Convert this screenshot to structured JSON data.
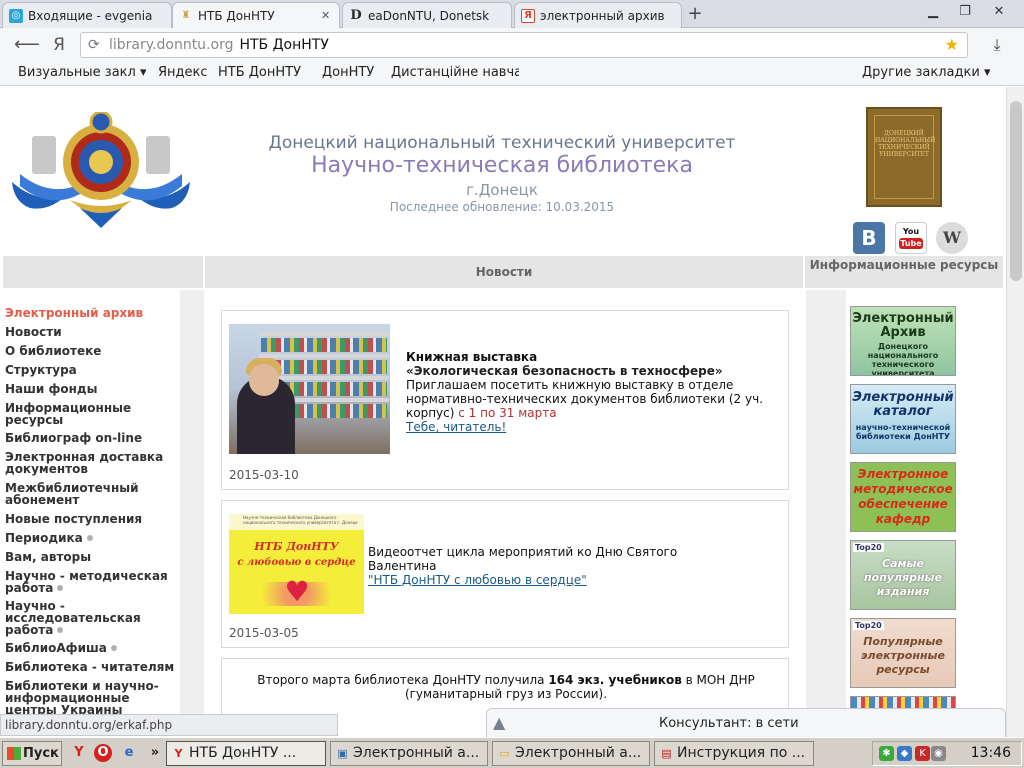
{
  "browser": {
    "tabs": [
      {
        "label": "Входящие - evgenia",
        "icon_color": "#2aa6d6"
      },
      {
        "label": "НТБ ДонНТУ",
        "icon_color": "#c8a040"
      },
      {
        "label": "eaDonNTU, Donetsk",
        "icon_color": "#2a2a2a"
      },
      {
        "label": "электронный архив",
        "icon_color": "#e04030"
      }
    ],
    "active_tab": 1,
    "window_controls": [
      "▁",
      "❐",
      "✕"
    ],
    "address": {
      "host": "library.donntu.org",
      "page": "НТБ ДонНТУ",
      "yandex_glyph": "Я"
    },
    "bookmarks": [
      "Визуальные закл ▾",
      "Яндекс",
      "НТБ ДонНТУ",
      "ДонНТУ",
      "Дистанційне навча",
      "Другие закладки ▾"
    ]
  },
  "header": {
    "university": "Донецкий национальный технический университет",
    "library": "Научно-техническая библиотека",
    "city": "г.Донецк",
    "updated": "Последнее обновление: 10.03.2015",
    "book_cover_text": "ДОНЕЦКИЙ НАЦИОНАЛЬНЫЙ ТЕХНИЧЕСКИЙ УНИВЕРСИТЕТ",
    "social": {
      "vk": "В",
      "youtube_top": "You",
      "youtube_bottom": "Tube",
      "wiki": "W"
    }
  },
  "section_bar": {
    "news": "Новости",
    "resources": "Информационные ресурсы"
  },
  "nav": [
    {
      "label": "Электронный архив",
      "active": true,
      "dot": false
    },
    {
      "label": "Новости",
      "active": false,
      "dot": false
    },
    {
      "label": "О библиотеке",
      "active": false,
      "dot": false
    },
    {
      "label": "Структура",
      "active": false,
      "dot": false
    },
    {
      "label": "Наши фонды",
      "active": false,
      "dot": false
    },
    {
      "label": "Информационные ресурсы",
      "active": false,
      "dot": false
    },
    {
      "label": "Библиограф on-line",
      "active": false,
      "dot": false
    },
    {
      "label": "Электронная доставка документов",
      "active": false,
      "dot": false
    },
    {
      "label": "Межбиблиотечный абонемент",
      "active": false,
      "dot": false
    },
    {
      "label": "Новые поступления",
      "active": false,
      "dot": false
    },
    {
      "label": "Периодика",
      "active": false,
      "dot": true
    },
    {
      "label": "Вам, авторы",
      "active": false,
      "dot": false
    },
    {
      "label": "Научно - методическая работа",
      "active": false,
      "dot": true
    },
    {
      "label": "Научно - исследовательская работа",
      "active": false,
      "dot": true
    },
    {
      "label": "БиблиоАфиша",
      "active": false,
      "dot": true
    },
    {
      "label": "Библиотека - читателям",
      "active": false,
      "dot": false
    },
    {
      "label": "Библиотеки и научно-информационные центры Украины",
      "active": false,
      "dot": false
    }
  ],
  "news": [
    {
      "title": "Книжная выставка",
      "subtitle": "«Экологическая безопасность в техносфере»",
      "text": "Приглашаем посетить книжную выставку в отделе нормативно-технических документов библиотеки (2 уч. корпус) ",
      "text_highlight": "с 1 по 31 марта",
      "link": "Тебе, читатель!",
      "date": "2015-03-10"
    },
    {
      "text": "Видеоотчет цикла мероприятий ко Дню Святого Валентина",
      "link": "\"НТБ ДонНТУ с любовью в сердце\"",
      "banner_line1": "НТБ ДонНТУ",
      "banner_line2": "с любовью в сердце",
      "banner_header": "Научно-техническая библиотека Донецкого национального технического университета г. Донецк",
      "date": "2015-03-05"
    },
    {
      "text_before": "Второго марта библиотека ДонНТУ получила ",
      "text_bold": "164 экз. учебников",
      "text_after": " в МОН ДНР (гуманитарный груз из России)."
    }
  ],
  "resources": [
    {
      "title": "Электронный Архив",
      "sub": "Донецкого национального технического университета"
    },
    {
      "title": "Электронный каталог",
      "sub": "научно-технической библиотеки ДонНТУ"
    },
    {
      "title": "Электронное методическое обеспечение кафедр"
    },
    {
      "badge": "Top20",
      "ghost": "Самые популярные издания"
    },
    {
      "badge": "Top20",
      "ghost": "Популярные электронные ресурсы"
    }
  ],
  "status_url": "library.donntu.org/erkaf.php",
  "consultant": "Консультант: в сети",
  "taskbar": {
    "start": "Пуск",
    "more": "»",
    "tasks": [
      {
        "label": "НТБ ДонНТУ ...",
        "icon": "Y",
        "icon_color": "#d42020"
      },
      {
        "label": "Электронный а...",
        "icon": "▣",
        "icon_color": "#3a6aa8"
      },
      {
        "label": "Электронный а...",
        "icon": "▭",
        "icon_color": "#d8a82a"
      },
      {
        "label": "Инструкция по ...",
        "icon": "▤",
        "icon_color": "#c02020"
      }
    ],
    "clock": "13:46"
  }
}
